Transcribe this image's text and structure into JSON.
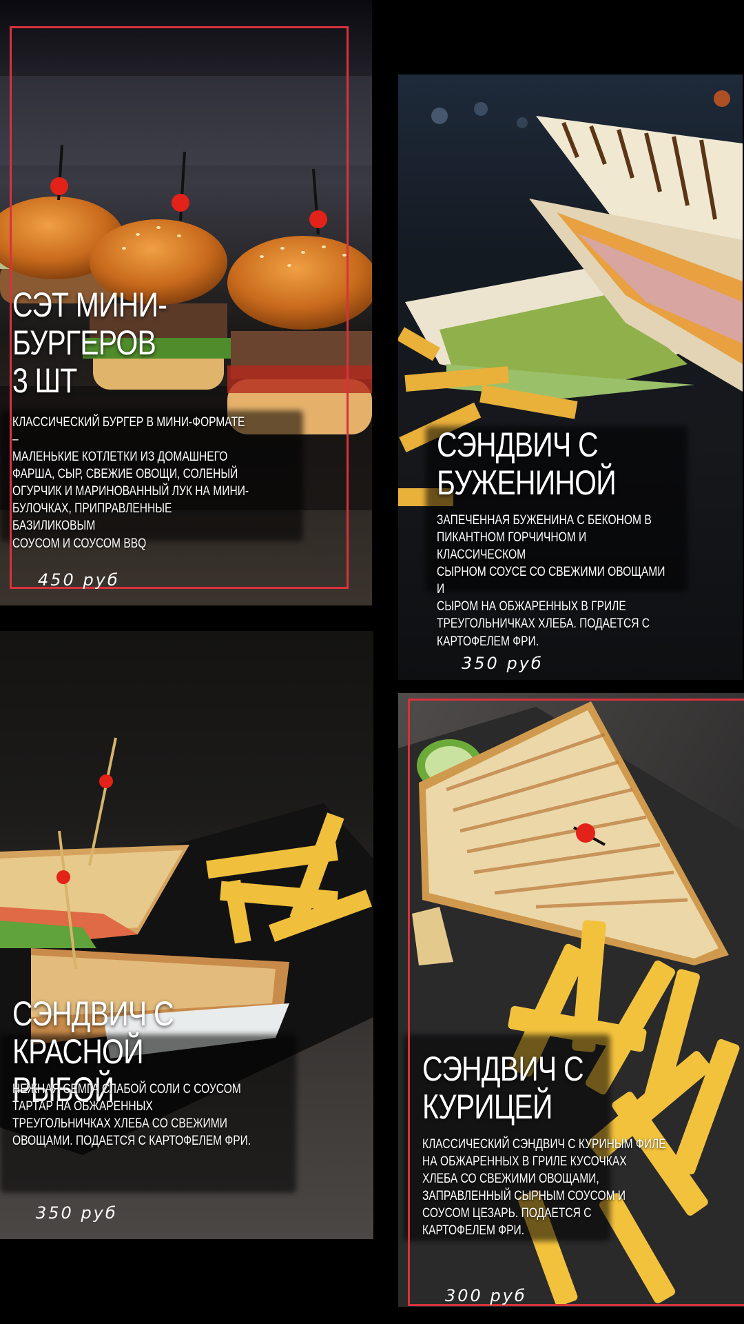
{
  "accent_color": "#d8323c",
  "items": [
    {
      "title": "СЭТ МИНИ-\nБУРГЕРОВ\n3 ШТ",
      "description": "КЛАССИЧЕСКИЙ БУРГЕР В МИНИ-ФОРМАТЕ –\nМАЛЕНЬКИЕ КОТЛЕТКИ ИЗ ДОМАШНЕГО\nФАРША, СЫР, СВЕЖИЕ ОВОЩИ, СОЛЕНЫЙ\nОГУРЧИК И МАРИНОВАННЫЙ ЛУК НА МИНИ-\nБУЛОЧКАХ, ПРИПРАВЛЕННЫЕ БАЗИЛИКОВЫМ\nСОУСОМ И СОУСОМ BBQ",
      "price": "450 руб",
      "image": "mini-burgers-photo"
    },
    {
      "title": "СЭНДВИЧ С\nБУЖЕНИНОЙ",
      "description": "ЗАПЕЧЕННАЯ БУЖЕНИНА С БЕКОНОМ В\nПИКАНТНОМ ГОРЧИЧНОМ И КЛАССИЧЕСКОМ\nСЫРНОМ СОУСЕ СО СВЕЖИМИ ОВОЩАМИ И\nСЫРОМ НА ОБЖАРЕННЫХ В ГРИЛЕ\nТРЕУГОЛЬНИЧКАХ ХЛЕБА. ПОДАЕТСЯ С\nКАРТОФЕЛЕМ ФРИ.",
      "price": "350 руб",
      "image": "pork-sandwich-photo"
    },
    {
      "title": "СЭНДВИЧ С\nКРАСНОЙ РЫБОЙ",
      "description": "НЕЖНАЯ СЕМГА СЛАБОЙ СОЛИ С СОУСОМ\nТАРТАР НА ОБЖАРЕННЫХ\nТРЕУГОЛЬНИЧКАХ ХЛЕБА СО СВЕЖИМИ\nОВОЩАМИ. ПОДАЕТСЯ С КАРТОФЕЛЕМ ФРИ.",
      "price": "350 руб",
      "image": "salmon-sandwich-photo"
    },
    {
      "title": "СЭНДВИЧ С\nКУРИЦЕЙ",
      "description": "КЛАССИЧЕСКИЙ СЭНДВИЧ С КУРИНЫМ ФИЛЕ\nНА ОБЖАРЕННЫХ В ГРИЛЕ КУСОЧКАХ\nХЛЕБА СО СВЕЖИМИ ОВОЩАМИ,\nЗАПРАВЛЕННЫЙ СЫРНЫМ СОУСОМ И\nСОУСОМ ЦЕЗАРЬ. ПОДАЕТСЯ С\nКАРТОФЕЛЕМ ФРИ.",
      "price": "300 руб",
      "image": "chicken-sandwich-photo"
    }
  ]
}
